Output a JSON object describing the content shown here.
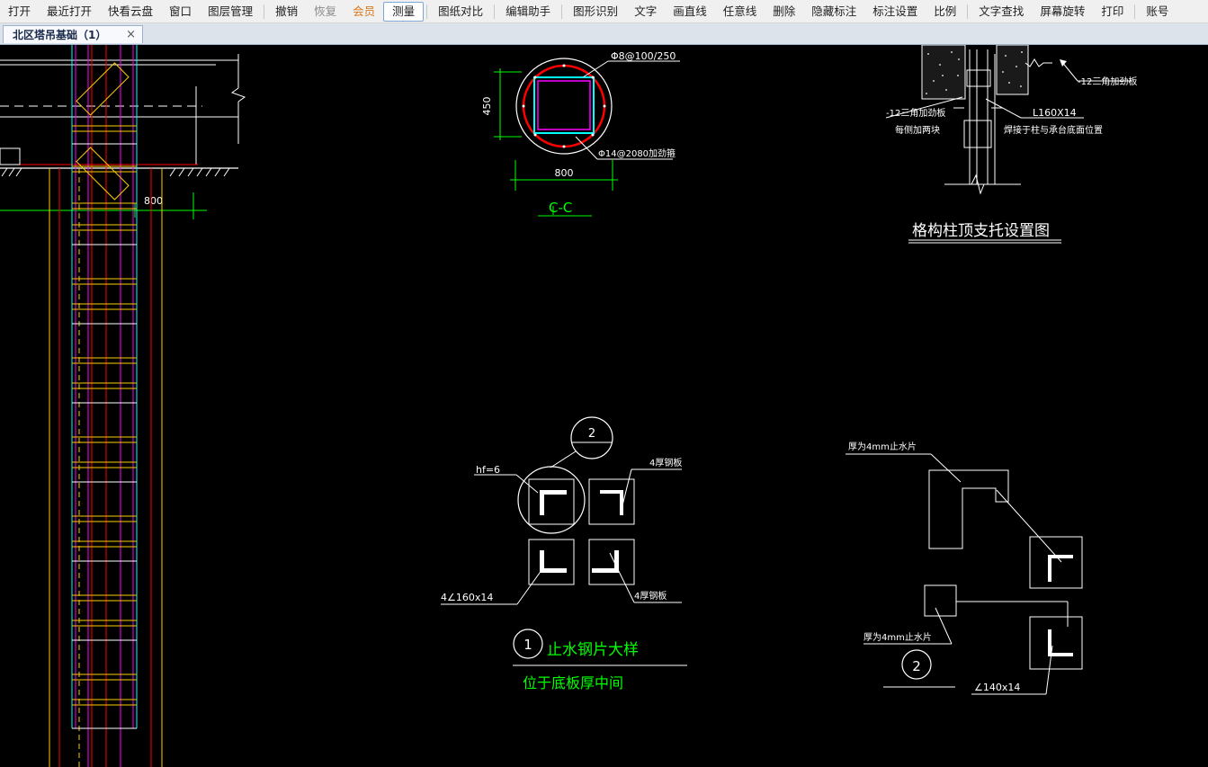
{
  "menu": [
    {
      "label": "打开"
    },
    {
      "label": "最近打开"
    },
    {
      "label": "快看云盘"
    },
    {
      "label": "窗口"
    },
    {
      "label": "图层管理",
      "sep_after": true
    },
    {
      "label": "撤销"
    },
    {
      "label": "恢复",
      "state": "disabled"
    },
    {
      "label": "会员",
      "state": "vip"
    },
    {
      "label": "测量",
      "state": "active",
      "sep_after": true
    },
    {
      "label": "图纸对比",
      "sep_after": true
    },
    {
      "label": "编辑助手",
      "sep_after": true
    },
    {
      "label": "图形识别"
    },
    {
      "label": "文字"
    },
    {
      "label": "画直线"
    },
    {
      "label": "任意线"
    },
    {
      "label": "删除"
    },
    {
      "label": "隐藏标注"
    },
    {
      "label": "标注设置"
    },
    {
      "label": "比例",
      "sep_after": true
    },
    {
      "label": "文字查找"
    },
    {
      "label": "屏幕旋转"
    },
    {
      "label": "打印",
      "sep_after": true
    },
    {
      "label": "账号"
    }
  ],
  "tab": {
    "title": "北区塔吊基础（1）",
    "close": "×"
  },
  "drawing": {
    "left_elevation": {
      "dim": "800"
    },
    "section_cc": {
      "title": "C-C",
      "note_top": "Φ8@100/250",
      "note_bottom": "Φ14@2080加劲箍",
      "dim_h": "450",
      "dim_w": "800"
    },
    "bracket_detail": {
      "title": "格构柱顶支托设置图",
      "label_stiffener_right": "-12三角加劲板",
      "label_stiffener_left": "-12三角加劲板",
      "label_each_side": "每侧加两块",
      "label_angle": "L160X14",
      "label_weld": "焊接于柱与承台底面位置"
    },
    "waterstop_detail_1": {
      "bubble_top": "2",
      "weld": "hf=6",
      "label_plate_top": "4厚钢板",
      "label_plate_bottom": "4厚钢板",
      "label_angle": "4∠160x14",
      "bubble": "1",
      "title": "止水钢片大样",
      "subtitle": "位于底板厚中间"
    },
    "waterstop_detail_2": {
      "label_top": "厚为4mm止水片",
      "label_bottom": "厚为4mm止水片",
      "label_angle": "∠140x14",
      "bubble": "2"
    }
  }
}
